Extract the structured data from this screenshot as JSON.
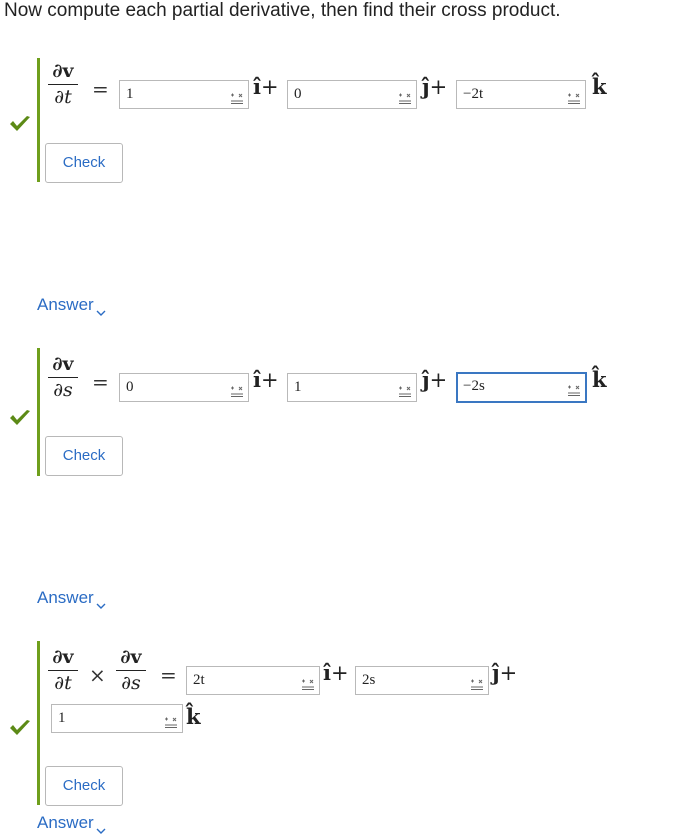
{
  "heading": "Now compute each partial derivative, then find their cross product.",
  "symbols": {
    "partial_v": "∂v",
    "partial_t": "∂t",
    "partial_s": "∂s",
    "equals": "=",
    "times": "×",
    "i_hat": "î",
    "j_hat": "ĵ",
    "k_hat": "k̂",
    "plus": "+"
  },
  "part1": {
    "i_value": "1",
    "j_value": "0",
    "k_value": "−2t",
    "check_label": "Check",
    "answer_label": "Answer"
  },
  "part2": {
    "i_value": "0",
    "j_value": "1",
    "k_value": "−2s",
    "check_label": "Check",
    "answer_label": "Answer"
  },
  "part3": {
    "i_value": "2t",
    "j_value": "2s",
    "k_value": "1",
    "check_label": "Check",
    "answer_label": "Answer"
  },
  "colors": {
    "correct_green": "#6f9f1c",
    "link_blue": "#2b6cc4",
    "focus_blue": "#3a77c2"
  },
  "icons": [
    "checkmark-icon",
    "keyboard-icon",
    "chevron-down-icon"
  ]
}
